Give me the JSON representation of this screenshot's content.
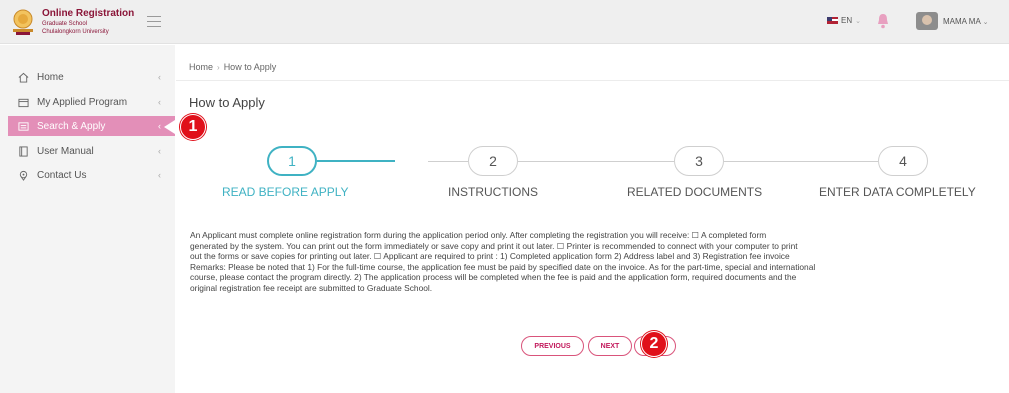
{
  "header": {
    "brand_title": "Online Registration",
    "brand_sub1": "Graduate School",
    "brand_sub2": "Chulalongkorn University",
    "language": "EN",
    "username": "MAMA MA",
    "colors": {
      "brand": "#8a1538",
      "bar": "#efefef"
    }
  },
  "sidebar": {
    "items": [
      {
        "label": "Home",
        "icon": "home-icon"
      },
      {
        "label": "My Applied Program",
        "icon": "folder-icon"
      },
      {
        "label": "Search & Apply",
        "icon": "search-grid-icon",
        "active": true
      },
      {
        "label": "User Manual",
        "icon": "book-icon"
      },
      {
        "label": "Contact Us",
        "icon": "location-pin-icon"
      }
    ],
    "active_color": "#e38fb8"
  },
  "annotations": {
    "badge1": "1",
    "badge2": "2",
    "badge_color": "#e0101a"
  },
  "breadcrumb": {
    "home": "Home",
    "current": "How to Apply"
  },
  "page": {
    "title": "How to Apply"
  },
  "steps": [
    {
      "number": "1",
      "label": "READ BEFORE APPLY",
      "active": true
    },
    {
      "number": "2",
      "label": "INSTRUCTIONS"
    },
    {
      "number": "3",
      "label": "RELATED DOCUMENTS"
    },
    {
      "number": "4",
      "label": "ENTER DATA COMPLETELY"
    }
  ],
  "step_color": "#3fb2c3",
  "body": {
    "line1": "An Applicant must complete online registration form during the application period only. After completing the registration you will receive: ☐ A completed form",
    "line2": "generated by the system. You can print out the form immediately or save copy and print it out later. ☐ Printer is recommended to connect with your computer to print",
    "line3": "out the forms or save copies for printing out later. ☐ Applicant are required to print : 1) Completed application form 2) Address label and 3) Registration fee invoice",
    "line4": "Remarks: Please be noted that 1) For the full-time course, the application fee must be paid by specified date on the invoice. As for the part-time, special and international",
    "line5": "course, please contact the program directly. 2) The application process will be completed when the fee is paid and the application form, required documents and the",
    "line6": "original registration fee receipt are submitted to Graduate School."
  },
  "buttons": {
    "previous": "PREVIOUS",
    "next": "NEXT",
    "color": "#c2185b"
  }
}
